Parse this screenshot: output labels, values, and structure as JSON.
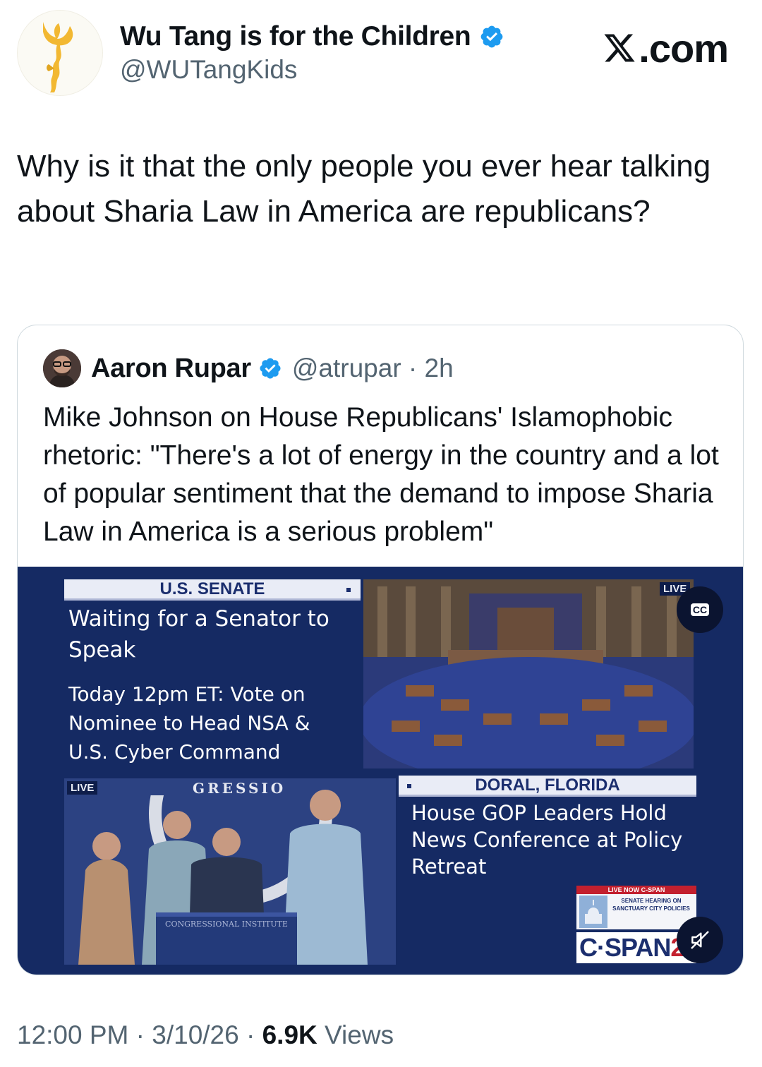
{
  "author": {
    "display_name": "Wu Tang is for the Children",
    "handle": "@WUTangKids"
  },
  "site": {
    "label": ".com"
  },
  "tweet": {
    "text": "Why is it that the only people you ever hear talking about Sharia Law in America are republicans?"
  },
  "quote": {
    "display_name": "Aaron Rupar",
    "handle": "@atrupar",
    "separator": "·",
    "age": "2h",
    "text": "Mike Johnson on House Republicans' Islamophobic rhetoric: \"There's a lot of energy in the country and a lot of popular sentiment that the demand to impose Sharia Law in America is a serious problem\"",
    "media": {
      "senate_banner": "U.S. SENATE",
      "senate_title": "Waiting for a Senator to Speak",
      "senate_sub": "Today 12pm ET: Vote on Nominee to Head NSA & U.S. Cyber Command",
      "live_top": "LIVE",
      "live_bottom": "LIVE",
      "doral_banner": "DORAL, FLORIDA",
      "doral_title": "House GOP Leaders Hold News Conference at Policy Retreat",
      "podium_text": "CONGRESSIONAL INSTITUTE",
      "seal_text": "GRESSIO",
      "cspan_live": "LIVE NOW C-SPAN",
      "cspan_program": "SENATE HEARING ON SANCTUARY CITY POLICIES",
      "cspan_logo": "C·SPAN",
      "cspan_num": "2",
      "cc_label": "CC",
      "cc_icon": "closed-captions-icon",
      "mute_icon": "speaker-muted-icon"
    }
  },
  "footer": {
    "time": "12:00 PM",
    "sep1": "·",
    "date": "3/10/26",
    "sep2": "·",
    "views_count": "6.9K",
    "views_label": "Views"
  },
  "colors": {
    "verified": "#1d9bf0",
    "secondary_text": "#536471",
    "broadcast_blue": "#152a63",
    "cspan_red": "#c3202e"
  }
}
